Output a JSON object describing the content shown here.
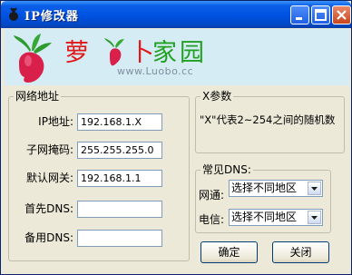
{
  "window": {
    "title": "IP修改器"
  },
  "banner": {
    "logo_chars": [
      "萝",
      "卜",
      "家",
      "园"
    ],
    "url": "www.Luobo.cc"
  },
  "network": {
    "legend": "网络地址",
    "ip_label": "IP地址:",
    "ip_value": "192.168.1.X",
    "mask_label": "子网掩码:",
    "mask_value": "255.255.255.0",
    "gateway_label": "默认网关:",
    "gateway_value": "192.168.1.1",
    "dns1_label": "首先DNS:",
    "dns1_value": "",
    "dns2_label": "备用DNS:",
    "dns2_value": ""
  },
  "xparam": {
    "legend": "X参数",
    "description": "\"X\"代表2~254之间的随机数"
  },
  "dns": {
    "legend": "常见DNS:",
    "unicom_label": "网通:",
    "unicom_selected": "选择不同地区",
    "telecom_label": "电信:",
    "telecom_selected": "选择不同地区"
  },
  "buttons": {
    "ok": "确定",
    "close": "关闭"
  }
}
